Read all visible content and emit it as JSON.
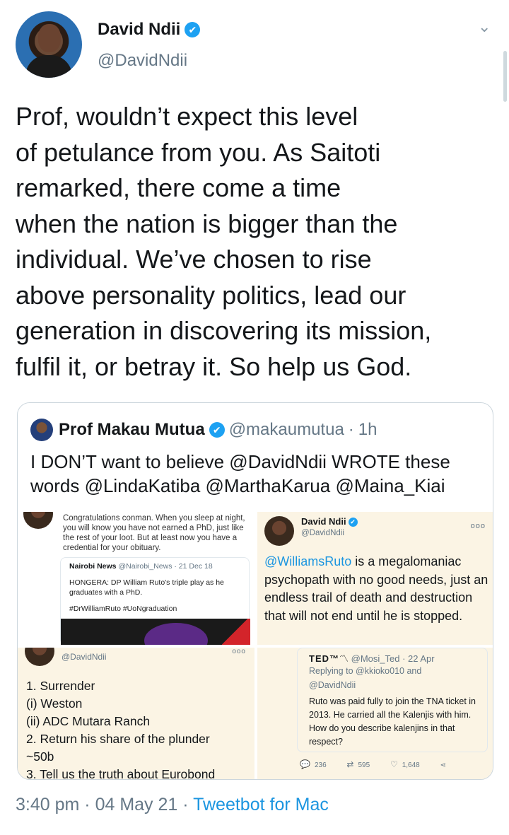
{
  "tweet": {
    "author_name": "David Ndii",
    "author_handle": "@DavidNdii",
    "verified_icon": "✔",
    "menu_icon": "⌄",
    "text_lines": [
      "Prof, wouldn’t expect this level",
      "of petulance from you. As Saitoti",
      "remarked, there come a time",
      "when the nation is bigger than the",
      "individual. We’ve chosen to rise",
      "above personality politics, lead our",
      "generation in discovering its mission,",
      "fulfil it, or betray it. So help us God."
    ],
    "time": "3:40 pm",
    "separator": "·",
    "date": "04 May 21",
    "client": "Tweetbot for Mac"
  },
  "quote": {
    "author_name": "Prof Makau Mutua",
    "author_handle": "@makaumutua",
    "separator": "·",
    "age": "1h",
    "text_lines": [
      "I DON’T want to believe @DavidNdii WROTE these",
      "words @LindaKatiba @MarthaKarua @Maina_Kiai"
    ],
    "images": {
      "img1": {
        "text": "Congratulations conman. When you sleep at night, you will know you have not earned a PhD, just like the rest of your loot. But at least now you have a credential for your obituary.",
        "card_source": "Nairobi News",
        "card_handle": "@Nairobi_News · 21 Dec 18",
        "card_headline": "HONGERA: DP William Ruto's triple play as he graduates with a PhD.",
        "card_tags": "#DrWilliamRuto #UoNgraduation"
      },
      "img2": {
        "name": "David Ndii",
        "handle": "@DavidNdii",
        "dots": "ooo",
        "mention": "@WilliamsRuto",
        "body": " is a megalomaniac psychopath with no good needs, just an endless trail of death and destruction that will not end until he is stopped."
      },
      "img3": {
        "handle": "@DavidNdii",
        "dots": "ooo",
        "lines": [
          "1. Surrender",
          "(i) Weston",
          "(ii) ADC Mutara Ranch",
          "2. Return his share of the plunder",
          "~50b",
          "3. Tell us the truth about Eurobond"
        ]
      },
      "img4": {
        "author": "TED™",
        "author_emoji": "〽",
        "handle_date": "@Mosi_Ted · 22 Apr",
        "reply_line1": "Replying to @kkioko010 and",
        "reply_line2": "@DavidNdii",
        "body": "Ruto was paid fully to join the TNA ticket in 2013. He carried all the Kalenjis with him. How do you describe kalenjins in that respect?",
        "replies": "236",
        "retweets": "595",
        "likes": "1,648"
      }
    }
  }
}
